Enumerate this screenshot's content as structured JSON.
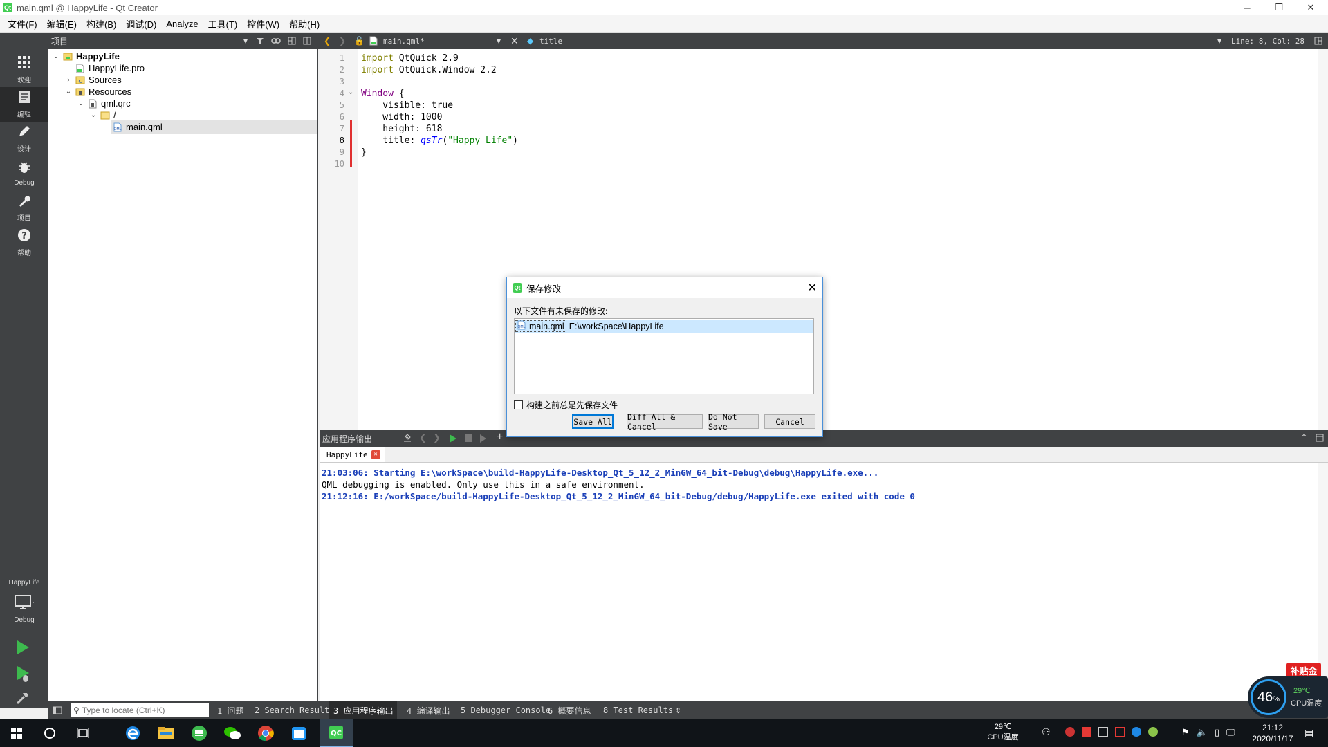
{
  "window": {
    "title": "main.qml @ HappyLife - Qt Creator",
    "minimize_glyph": "─",
    "restore_glyph": "❐",
    "close_glyph": "✕"
  },
  "menu": [
    "文件(F)",
    "编辑(E)",
    "构建(B)",
    "调试(D)",
    "Analyze",
    "工具(T)",
    "控件(W)",
    "帮助(H)"
  ],
  "projects_pane": {
    "label": "项目"
  },
  "editor_toolbar": {
    "file": "main.qml*",
    "symbol": "title",
    "position": "Line: 8, Col: 28"
  },
  "modes": [
    {
      "label": "欢迎",
      "icon": "grid"
    },
    {
      "label": "编辑",
      "icon": "edit"
    },
    {
      "label": "设计",
      "icon": "pencil"
    },
    {
      "label": "Debug",
      "icon": "bug"
    },
    {
      "label": "项目",
      "icon": "wrench"
    },
    {
      "label": "帮助",
      "icon": "help"
    }
  ],
  "kit": {
    "project": "HappyLife",
    "config": "Debug"
  },
  "tree": [
    {
      "label": "HappyLife",
      "bold": true
    },
    {
      "label": "HappyLife.pro"
    },
    {
      "label": "Sources"
    },
    {
      "label": "Resources"
    },
    {
      "label": "qml.qrc"
    },
    {
      "label": "/"
    },
    {
      "label": "main.qml",
      "selected": true
    }
  ],
  "code": {
    "line_numbers": [
      "1",
      "2",
      "3",
      "4",
      "5",
      "6",
      "7",
      "8",
      "9",
      "10"
    ],
    "l1": {
      "kw": "import",
      "rest": " QtQuick 2.9"
    },
    "l2": {
      "kw": "import",
      "rest": " QtQuick.Window 2.2"
    },
    "l4": {
      "ty": "Window",
      "rest": " {"
    },
    "l5": {
      "prop": "    visible: true"
    },
    "l6": {
      "prop": "    width: 1000"
    },
    "l7": {
      "prop": "    height: 618"
    },
    "l8": {
      "pre": "    title: ",
      "fn": "qsTr",
      "open": "(",
      "str": "\"Happy Life\"",
      "close": ")"
    },
    "l9": {
      "text": "}"
    }
  },
  "output": {
    "pane_title": "应用程序输出",
    "tab": "HappyLife",
    "lines": [
      "21:03:06: Starting E:\\workSpace\\build-HappyLife-Desktop_Qt_5_12_2_MinGW_64_bit-Debug\\debug\\HappyLife.exe...",
      "QML debugging is enabled. Only use this in a safe environment.",
      "21:12:16: E:/workSpace/build-HappyLife-Desktop_Qt_5_12_2_MinGW_64_bit-Debug/debug/HappyLife.exe exited with code 0"
    ]
  },
  "statusbar": {
    "locate_placeholder": "Type to locate (Ctrl+K)",
    "tabs": [
      "1 问题",
      "2 Search Results",
      "3 应用程序输出",
      "4 编译输出",
      "5 Debugger Console",
      "6 概要信息",
      "8 Test Results"
    ]
  },
  "dialog": {
    "title": "保存修改",
    "message": "以下文件有未保存的修改:",
    "file_name": "main.qml",
    "file_path": "E:\\workSpace\\HappyLife",
    "checkbox": "构建之前总是先保存文件",
    "buttons": {
      "save_all": "Save All",
      "diff": "Diff All & Cancel",
      "do_not_save": "Do Not Save",
      "cancel": "Cancel"
    }
  },
  "widget": {
    "cpu_percent": "46",
    "percent_sign": "%",
    "temp": "29℃",
    "temp_label": "CPU温度",
    "promo": "补贴金"
  },
  "taskbar": {
    "cpu_temp": "29℃",
    "cpu_label": "CPU温度",
    "time": "21:12",
    "date": "2020/11/17"
  },
  "colors": {
    "dark_bar": "#404244",
    "selection": "#cce8ff",
    "accent": "#0078d7",
    "qt_green": "#41cd52"
  }
}
